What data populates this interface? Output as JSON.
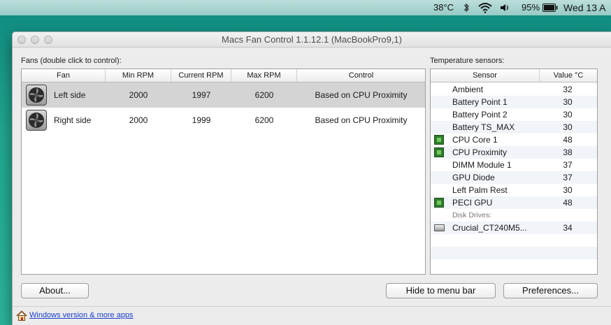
{
  "menubar": {
    "temperature": "38°C",
    "battery_percent": "95%",
    "clock": "Wed 13 A",
    "icons": [
      "bluetooth-icon",
      "wifi-icon",
      "volume-icon",
      "battery-icon"
    ]
  },
  "window": {
    "title": "Macs Fan Control 1.1.12.1 (MacBookPro9,1)"
  },
  "fans": {
    "label": "Fans (double click to control):",
    "columns": [
      "Fan",
      "Min RPM",
      "Current RPM",
      "Max RPM",
      "Control"
    ],
    "rows": [
      {
        "name": "Left side",
        "min_rpm": "2000",
        "current_rpm": "1997",
        "max_rpm": "6200",
        "control": "Based on CPU Proximity",
        "selected": true
      },
      {
        "name": "Right side",
        "min_rpm": "2000",
        "current_rpm": "1999",
        "max_rpm": "6200",
        "control": "Based on CPU Proximity",
        "selected": false
      }
    ]
  },
  "sensors": {
    "label": "Temperature sensors:",
    "columns": [
      "Sensor",
      "Value °C"
    ],
    "rows": [
      {
        "name": "Ambient",
        "value": "32",
        "icon": "none"
      },
      {
        "name": "Battery Point 1",
        "value": "30",
        "icon": "none"
      },
      {
        "name": "Battery Point 2",
        "value": "30",
        "icon": "none"
      },
      {
        "name": "Battery TS_MAX",
        "value": "30",
        "icon": "none"
      },
      {
        "name": "CPU Core 1",
        "value": "48",
        "icon": "chip-icon"
      },
      {
        "name": "CPU Proximity",
        "value": "38",
        "icon": "chip-icon"
      },
      {
        "name": "DIMM Module 1",
        "value": "37",
        "icon": "none"
      },
      {
        "name": "GPU Diode",
        "value": "37",
        "icon": "none"
      },
      {
        "name": "Left Palm Rest",
        "value": "30",
        "icon": "none"
      },
      {
        "name": "PECI GPU",
        "value": "48",
        "icon": "chip-icon"
      }
    ],
    "disk_group_label": "Disk Drives:",
    "disk_rows": [
      {
        "name": "Crucial_CT240M5...",
        "value": "34",
        "icon": "disk-drive-icon"
      }
    ]
  },
  "buttons": {
    "about": "About...",
    "hide": "Hide to menu bar",
    "preferences": "Preferences..."
  },
  "footer": {
    "link": "Windows version & more apps"
  },
  "colors": {
    "selection": "#d4d4d4",
    "link": "#1a3fd0",
    "chip": "#2f7d2a"
  }
}
